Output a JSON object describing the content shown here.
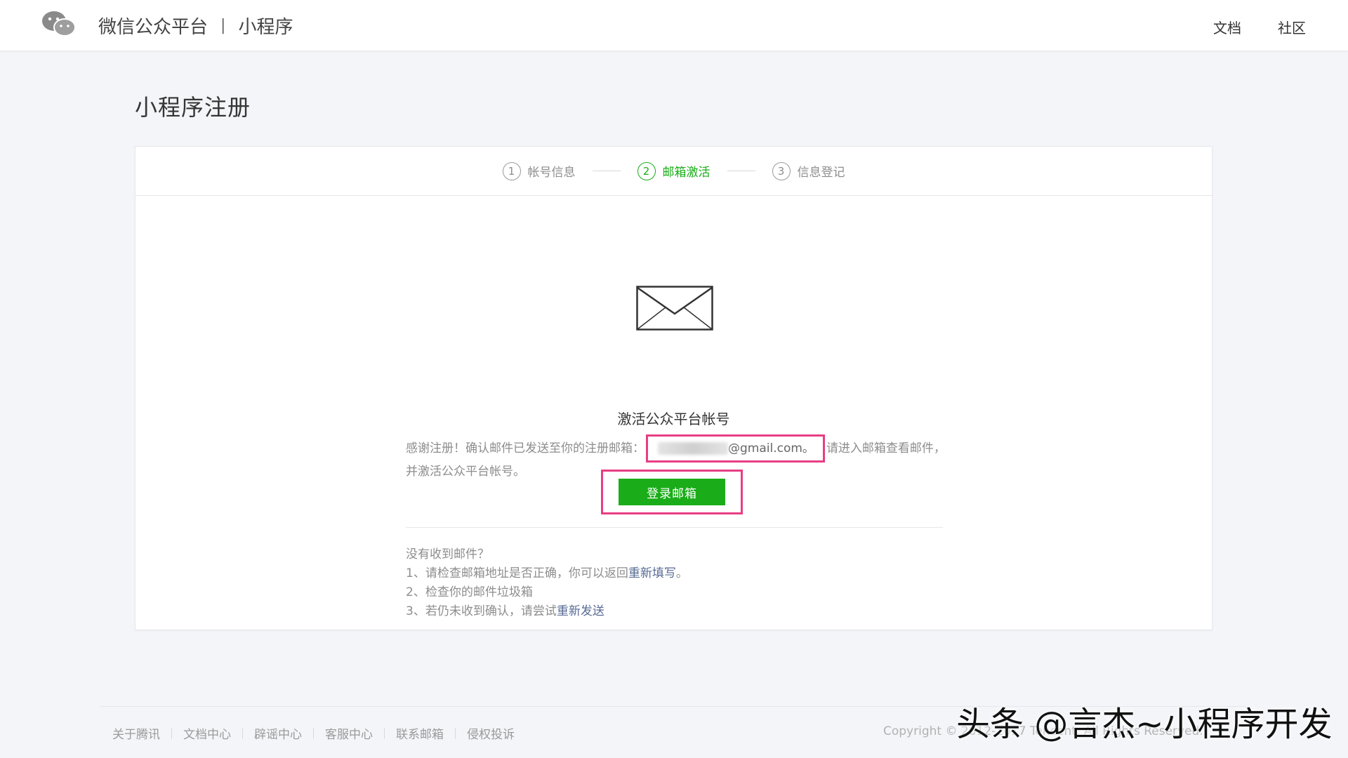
{
  "header": {
    "brand": "微信公众平台",
    "separator": "|",
    "product": "小程序",
    "links": [
      "文档",
      "社区"
    ]
  },
  "page": {
    "title": "小程序注册"
  },
  "steps": [
    {
      "num": "1",
      "label": "帐号信息",
      "active": false
    },
    {
      "num": "2",
      "label": "邮箱激活",
      "active": true
    },
    {
      "num": "3",
      "label": "信息登记",
      "active": false
    }
  ],
  "activation": {
    "title": "激活公众平台帐号",
    "desc_before": "感谢注册！确认邮件已发送至你的注册邮箱：",
    "email_visible": "@gmail.com。",
    "desc_after": "请进入邮箱查看邮件，并激活公众平台帐号。",
    "login_button": "登录邮箱"
  },
  "help": {
    "question": "没有收到邮件？",
    "item1_text": "1、请检查邮箱地址是否正确，你可以返回",
    "item1_link": "重新填写",
    "item1_end": "。",
    "item2_text": "2、检查你的邮件垃圾箱",
    "item3_text": "3、若仍未收到确认，请尝试",
    "item3_link": "重新发送"
  },
  "footer": {
    "links": [
      "关于腾讯",
      "文档中心",
      "辟谣中心",
      "客服中心",
      "联系邮箱",
      "侵权投诉"
    ],
    "copyright": "Copyright © 2012-2017 Tencent. All Rights Reserved."
  },
  "watermark": "头条 @言杰~小程序开发",
  "colors": {
    "accent_green": "#1aad19",
    "highlight_pink": "#e83e84",
    "link_blue": "#576b95"
  }
}
